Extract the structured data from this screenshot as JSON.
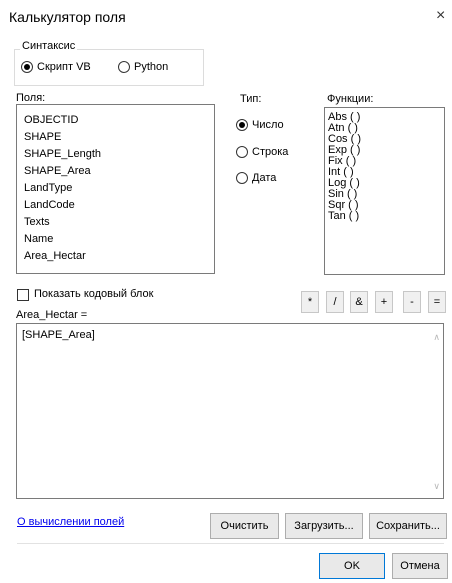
{
  "window": {
    "title": "Калькулятор поля",
    "close": "×"
  },
  "syntax": {
    "label": "Синтаксис",
    "options": [
      "Скрипт VB",
      "Python"
    ]
  },
  "fields": {
    "label": "Поля:",
    "items": [
      "OBJECTID",
      "SHAPE",
      "SHAPE_Length",
      "SHAPE_Area",
      "LandType",
      "LandCode",
      "Texts",
      "Name",
      "Area_Hectar"
    ]
  },
  "type": {
    "label": "Тип:",
    "options": [
      "Число",
      "Строка",
      "Дата"
    ]
  },
  "functions": {
    "label": "Функции:",
    "items": [
      "Abs ( )",
      "Atn ( )",
      "Cos ( )",
      "Exp ( )",
      "Fix ( )",
      "Int ( )",
      "Log ( )",
      "Sin ( )",
      "Sqr ( )",
      "Tan ( )"
    ]
  },
  "codeblock": {
    "label": "Показать кодовый блок"
  },
  "operators": [
    "*",
    "/",
    "&",
    "+",
    "-",
    "="
  ],
  "expression": {
    "label": "Area_Hectar =",
    "value": "[SHAPE_Area]"
  },
  "footer": {
    "help_link": "О вычислении полей",
    "clear": "Очистить",
    "load": "Загрузить...",
    "save": "Сохранить...",
    "ok": "OK",
    "cancel": "Отмена"
  }
}
